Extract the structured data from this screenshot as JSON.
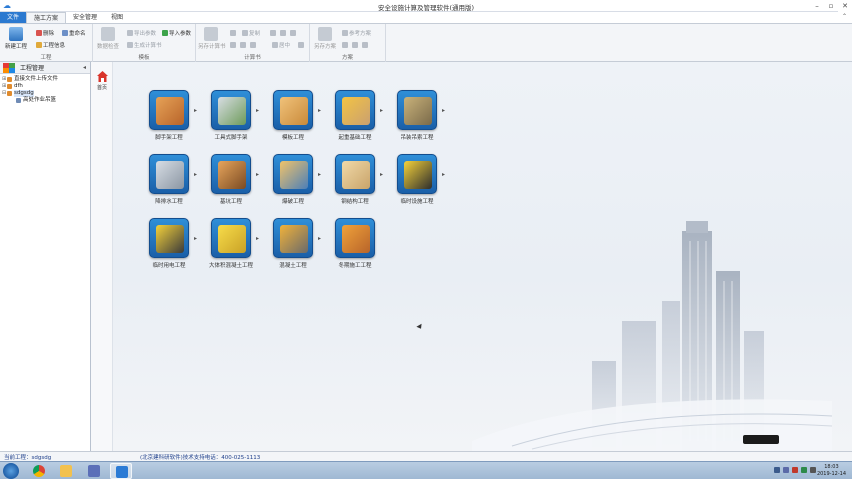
{
  "window": {
    "title": "安全设施计算及管理软件(通用版)"
  },
  "tabs": [
    {
      "label": "文件"
    },
    {
      "label": "施工方案"
    },
    {
      "label": "安全管理"
    },
    {
      "label": "视图"
    }
  ],
  "ribbon": {
    "groups": {
      "project": {
        "title": "工程",
        "new_project": "新建工程",
        "delete": "删除",
        "rename": "重命名",
        "project_info": "工程信息"
      },
      "template": {
        "title": "模板",
        "data_check": "数据检查",
        "export_params": "导出参数",
        "import_params": "导入参数",
        "gen_calc_book": "生成计算书"
      },
      "calc_book": {
        "title": "计算书",
        "open_calc_book": "另存计算书",
        "copy": "复制",
        "center": "居中"
      },
      "plan": {
        "title": "方案",
        "export_plan": "另存方案",
        "ref_plan": "参考方案"
      }
    }
  },
  "left_panel": {
    "title": "工程管理",
    "tree": [
      {
        "label": "直接文件上传文件",
        "level": 0
      },
      {
        "label": "dfh",
        "level": 0
      },
      {
        "label": "sdgsdg",
        "level": 0,
        "selected": true
      },
      {
        "label": "高处作业吊篮",
        "level": 1
      }
    ]
  },
  "home": {
    "label": "首页"
  },
  "modules": [
    {
      "label": "脚手架工程",
      "icon": "scaffold-icon"
    },
    {
      "label": "工具式脚手架",
      "icon": "tool-scaffold-icon"
    },
    {
      "label": "模板工程",
      "icon": "formwork-icon"
    },
    {
      "label": "起重基础工程",
      "icon": "crane-foundation-icon"
    },
    {
      "label": "吊装吊索工程",
      "icon": "hoisting-icon"
    },
    {
      "label": "降排水工程",
      "icon": "drainage-icon"
    },
    {
      "label": "基坑工程",
      "icon": "foundation-pit-icon"
    },
    {
      "label": "爆破工程",
      "icon": "blasting-icon"
    },
    {
      "label": "钢结构工程",
      "icon": "steel-structure-icon"
    },
    {
      "label": "临时设施工程",
      "icon": "temporary-facility-icon"
    },
    {
      "label": "临时用电工程",
      "icon": "temporary-power-icon"
    },
    {
      "label": "大体积混凝土工程",
      "icon": "mass-concrete-icon"
    },
    {
      "label": "混凝土工程",
      "icon": "concrete-icon"
    },
    {
      "label": "冬期施工工程",
      "icon": "winter-construction-icon"
    }
  ],
  "status": {
    "current_project": "当前工程：sdgsdg",
    "support": "(北京建科研软件)技术支持电话：400-025-1113"
  },
  "taskbar": {
    "time": "18:03",
    "date": "2019-12-14"
  },
  "colors": {
    "accent": "#2b79d0",
    "tile_top": "#2f8fd8",
    "tile_bottom": "#1a5fa8"
  }
}
